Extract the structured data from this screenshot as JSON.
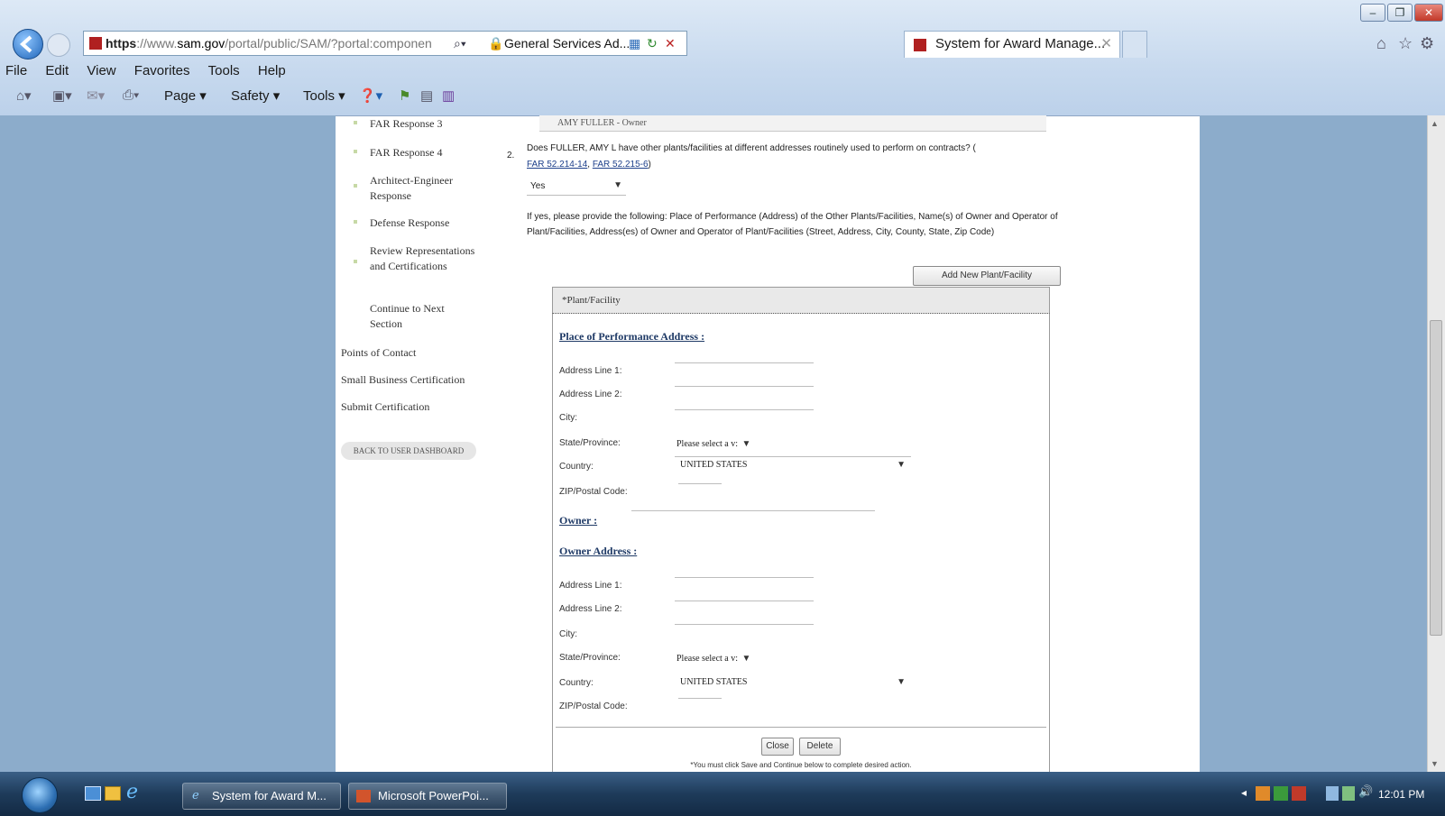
{
  "browser": {
    "url_protocol": "https",
    "url_host_prefix": "://www.",
    "url_host": "sam.gov",
    "url_path": "/portal/public/SAM/?portal:componen",
    "site_identity": "General Services Ad...",
    "tab_title": "System for Award Manage...",
    "menu": [
      "File",
      "Edit",
      "View",
      "Favorites",
      "Tools",
      "Help"
    ],
    "command_bar": {
      "page": "Page ▾",
      "safety": "Safety ▾",
      "tools": "Tools ▾"
    }
  },
  "nav": {
    "sub_items": [
      "FAR Response 3",
      "FAR Response 4",
      "Architect-Engineer Response",
      "Defense Response",
      "Review Representations and Certifications",
      "Continue to Next Section"
    ],
    "sections": [
      "Points of Contact",
      "Small Business Certification",
      "Submit Certification"
    ],
    "back_button": "BACK TO USER DASHBOARD"
  },
  "content": {
    "owner_display": "AMY FULLER - Owner",
    "question_number": "2.",
    "question_text": "Does FULLER, AMY L have other plants/facilities at different addresses routinely used to perform on contracts? (",
    "link1": "FAR 52.214-14",
    "link2": "FAR 52.215-6",
    "link_sep": ",",
    "link_close": ")",
    "answer": "Yes",
    "instructions": "If yes, please provide the following: Place of Performance (Address) of the Other Plants/Facilities, Name(s) of Owner and Operator of Plant/Facilities, Address(es) of Owner and Operator of Plant/Facilities (Street, Address, City, County, State, Zip Code)",
    "add_button": "Add New Plant/Facility",
    "panel": {
      "title": "*Plant/Facility",
      "pop_heading": "Place of Performance Address :",
      "owner_label": "Owner :",
      "owner_addr_heading": "Owner Address :",
      "labels": {
        "addr1": "Address Line 1:",
        "addr2": "Address Line 2:",
        "city": "City:",
        "state": "State/Province:",
        "country": "Country:",
        "zip": "ZIP/Postal Code:"
      },
      "state_placeholder": "Please select a v:",
      "country_value": "UNITED STATES",
      "close_button": "Close",
      "delete_button": "Delete",
      "footer_note": "*You must click Save and Continue below to complete desired action."
    }
  },
  "taskbar": {
    "ie_task": "System for Award M...",
    "ppt_task": "Microsoft PowerPoi...",
    "clock": "12:01 PM"
  }
}
